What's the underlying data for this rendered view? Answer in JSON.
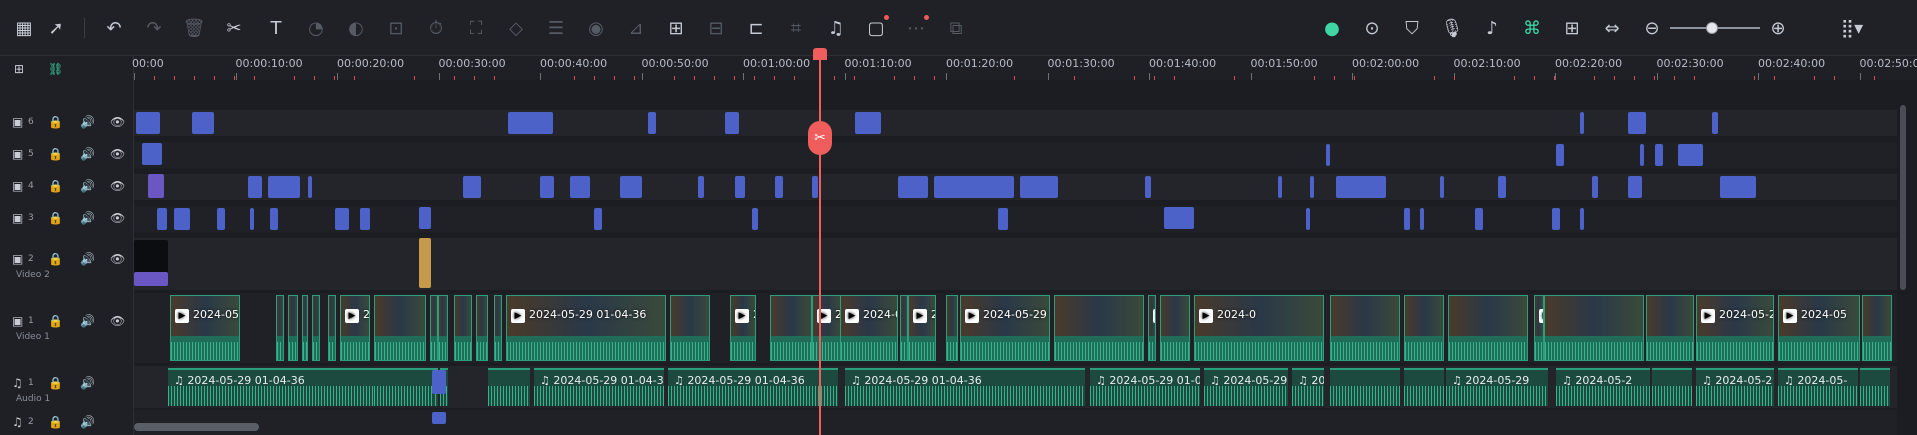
{
  "toolbar": {
    "left_icons": [
      "layout-icon",
      "select-arrow-icon",
      "undo-icon",
      "redo-icon",
      "delete-icon",
      "cut-icon",
      "text-icon",
      "speed-icon",
      "color-icon",
      "ai-text-icon",
      "timer-icon",
      "crop-frame-icon",
      "mask-icon",
      "adjust-icon",
      "audio-wave-icon",
      "audio-stretch-icon",
      "tts-icon",
      "ai-voice-icon",
      "freeze-icon",
      "crop-icon",
      "beat-icon",
      "auto-reframe-icon",
      "ai-caption-icon",
      "stabilize-icon"
    ],
    "right_icons": [
      "ai-mate-icon",
      "render-preview-icon",
      "marker-icon",
      "mic-icon",
      "audio-mixer-icon",
      "smart-scene-icon",
      "keyframe-icon",
      "fit-timeline-icon",
      "zoom-out-icon",
      "zoom-in-icon",
      "layout-menu-icon"
    ],
    "zoom_level": 0.55
  },
  "ruler": {
    "ticks": [
      "00:00",
      "00:00:10:00",
      "00:00:20:00",
      "00:00:30:00",
      "00:00:40:00",
      "00:00:50:00",
      "00:01:00:00",
      "00:01:10:00",
      "00:01:20:00",
      "00:01:30:00",
      "00:01:40:00",
      "00:01:50:00",
      "00:02:00:00",
      "00:02:10:00",
      "00:02:20:00",
      "00:02:30:00",
      "00:02:40:00",
      "00:02:50:00"
    ]
  },
  "tracks": [
    {
      "num": "6",
      "sub": ""
    },
    {
      "num": "5",
      "sub": ""
    },
    {
      "num": "4",
      "sub": ""
    },
    {
      "num": "3",
      "sub": ""
    },
    {
      "num": "2",
      "sub": "Video 2"
    },
    {
      "num": "1",
      "sub": "Video 1"
    },
    {
      "num": "1",
      "sub": "Audio 1"
    },
    {
      "num": "2",
      "sub": ""
    }
  ],
  "video_clips": [
    "2024-05-29 01",
    "2024",
    "2024-05-29 01-04-36",
    "202",
    "20",
    "2024-05",
    "2024-05-2",
    "2024-05-29 01-04",
    "2024-0",
    "2024-0",
    "2024-05-2",
    "2024-05-2",
    "2024-05"
  ],
  "audio_clips": [
    "2024-05-29 01-04-36",
    "2024-05-29 01-04-36",
    "2024-05-29 01-04-36",
    "2024-05-29 01-04-36",
    "2024-05-29 01-04-36",
    "2024-05-29 01-04-36",
    "2024-0",
    "2024-05-29",
    "2024-05-2",
    "2024-05-2",
    "2024-05-"
  ],
  "colors": {
    "accent": "#3fd6a3",
    "playhead": "#f05d5d",
    "title_clip": "#4c62c9",
    "video_clip": "#1f6c58"
  }
}
